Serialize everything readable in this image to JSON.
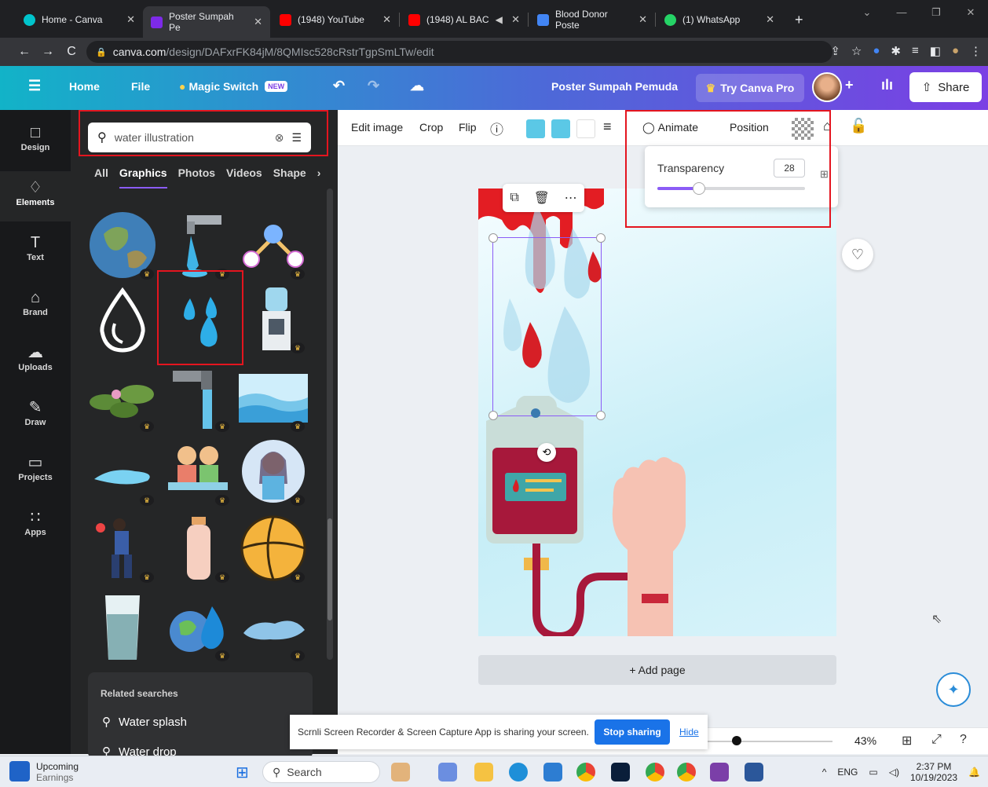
{
  "browser": {
    "tabs": [
      {
        "title": "Home - Canva",
        "color": "#00c4cc"
      },
      {
        "title": "Poster Sumpah Pe",
        "color": "#7d2ae8"
      },
      {
        "title": "(1948) YouTube",
        "color": "#ff0000"
      },
      {
        "title": "(1948) AL BAC",
        "color": "#ff0000"
      },
      {
        "title": "Blood Donor Poste",
        "color": "#4285f4"
      },
      {
        "title": "(1) WhatsApp",
        "color": "#25d366"
      }
    ],
    "url_host": "canva.com",
    "url_path": "/design/DAFxrFK84jM/8QMIsc528cRstrTgpSmLTw/edit"
  },
  "header": {
    "home": "Home",
    "file": "File",
    "magic_switch": "Magic Switch",
    "new_badge": "NEW",
    "doc_title": "Poster Sumpah Pemuda",
    "try_pro": "Try Canva Pro",
    "share": "Share"
  },
  "rail": [
    {
      "label": "Design",
      "icon": "□"
    },
    {
      "label": "Elements",
      "icon": "♢"
    },
    {
      "label": "Text",
      "icon": "T"
    },
    {
      "label": "Brand",
      "icon": "⌂"
    },
    {
      "label": "Uploads",
      "icon": "☁"
    },
    {
      "label": "Draw",
      "icon": "✎"
    },
    {
      "label": "Projects",
      "icon": "▭"
    },
    {
      "label": "Apps",
      "icon": "∷"
    }
  ],
  "panel": {
    "search_value": "water illustration",
    "tabs": [
      "All",
      "Graphics",
      "Photos",
      "Videos",
      "Shape"
    ],
    "related_title": "Related searches",
    "related": [
      "Water splash",
      "Water drop"
    ]
  },
  "toolbar": {
    "edit_image": "Edit image",
    "crop": "Crop",
    "flip": "Flip",
    "animate": "Animate",
    "position": "Position",
    "swatches": [
      "#5bc8e6",
      "#5bc8e6",
      "#ffffff"
    ]
  },
  "transparency": {
    "label": "Transparency",
    "value": "28",
    "level": 0.28
  },
  "canvas": {
    "add_page": "+ Add page",
    "zoom": "43%"
  },
  "sharebar": {
    "message": "Scrnli Screen Recorder & Screen Capture App is sharing your screen.",
    "stop": "Stop sharing",
    "hide": "Hide"
  },
  "taskbar": {
    "weather_title": "Upcoming",
    "weather_sub": "Earnings",
    "search": "Search",
    "lang": "ENG",
    "time": "2:37 PM",
    "date": "10/19/2023"
  }
}
